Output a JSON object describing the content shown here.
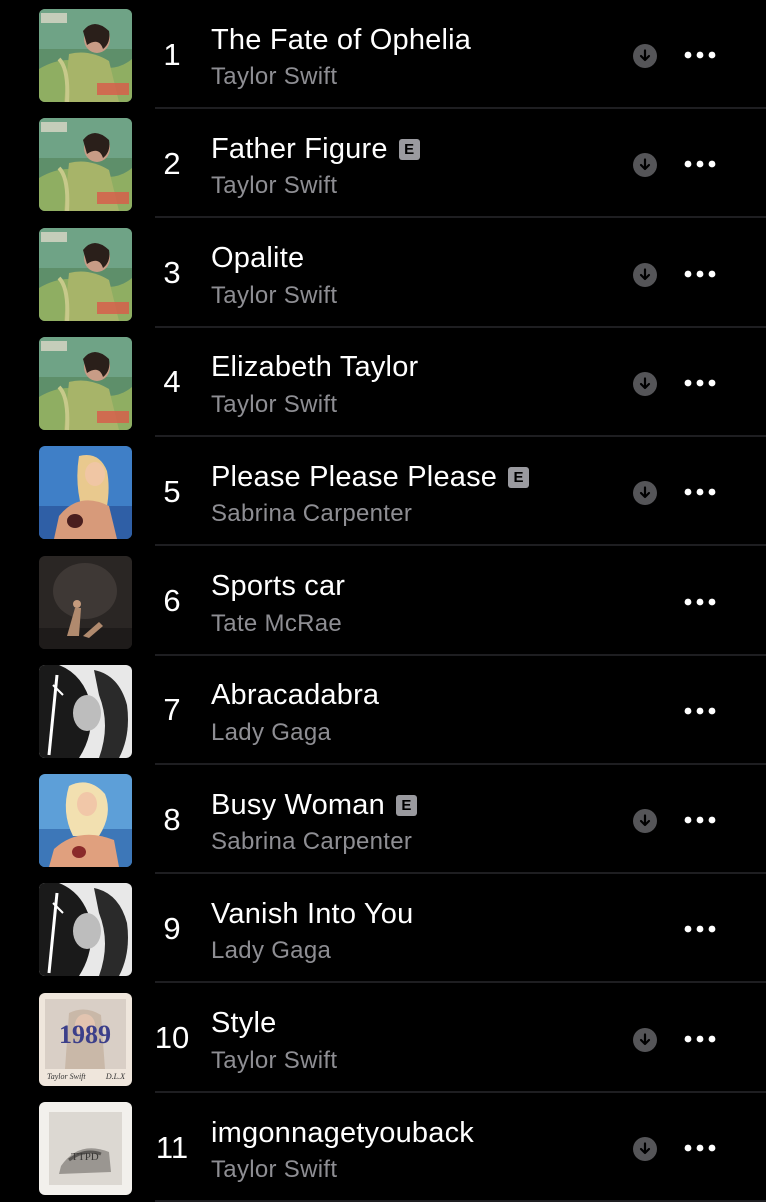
{
  "colors": {
    "background": "#000000",
    "title": "#ffffff",
    "artist": "#8e8e93",
    "explicit_badge": "#9a9a9f",
    "separator": "#1e1e21"
  },
  "icons": {
    "download": "download-arrow-icon",
    "more": "more-ellipsis-icon",
    "explicit": "explicit-badge"
  },
  "explicit_label": "E",
  "songs": [
    {
      "rank": "1",
      "title": "The Fate of Ophelia",
      "artist": "Taylor Swift",
      "explicit": false,
      "downloadable": true,
      "art": "showgirl"
    },
    {
      "rank": "2",
      "title": "Father Figure",
      "artist": "Taylor Swift",
      "explicit": true,
      "downloadable": true,
      "art": "showgirl"
    },
    {
      "rank": "3",
      "title": "Opalite",
      "artist": "Taylor Swift",
      "explicit": false,
      "downloadable": true,
      "art": "showgirl"
    },
    {
      "rank": "4",
      "title": "Elizabeth Taylor",
      "artist": "Taylor Swift",
      "explicit": false,
      "downloadable": true,
      "art": "showgirl"
    },
    {
      "rank": "5",
      "title": "Please Please Please",
      "artist": "Sabrina Carpenter",
      "explicit": true,
      "downloadable": true,
      "art": "blue-portrait"
    },
    {
      "rank": "6",
      "title": "Sports car",
      "artist": "Tate McRae",
      "explicit": false,
      "downloadable": false,
      "art": "dark-studio"
    },
    {
      "rank": "7",
      "title": "Abracadabra",
      "artist": "Lady Gaga",
      "explicit": false,
      "downloadable": false,
      "art": "bw-portrait"
    },
    {
      "rank": "8",
      "title": "Busy Woman",
      "artist": "Sabrina Carpenter",
      "explicit": true,
      "downloadable": true,
      "art": "blue-portrait-2"
    },
    {
      "rank": "9",
      "title": "Vanish Into You",
      "artist": "Lady Gaga",
      "explicit": false,
      "downloadable": false,
      "art": "bw-portrait"
    },
    {
      "rank": "10",
      "title": "Style",
      "artist": "Taylor Swift",
      "explicit": false,
      "downloadable": true,
      "art": "1989",
      "art_text": {
        "numbers": "1989",
        "signature": "Taylor Swift",
        "edition": "D.L.X"
      }
    },
    {
      "rank": "11",
      "title": "imgonnagetyouback",
      "artist": "Taylor Swift",
      "explicit": false,
      "downloadable": true,
      "art": "ttpd",
      "art_text": {
        "monogram": "TTPD"
      }
    }
  ]
}
